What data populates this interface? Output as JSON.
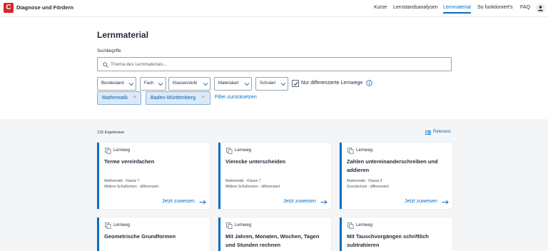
{
  "header": {
    "logo_letter": "C",
    "brand": "Diagnose und Fördern",
    "nav": [
      "Kurse",
      "Lernstandsanalysen",
      "Lernmaterial",
      "So funktioniert's",
      "FAQ"
    ],
    "active_nav": "Lernmaterial",
    "accent_color": "#0a6dc2"
  },
  "search": {
    "title": "Lernmaterial",
    "label": "Suchbegriffe",
    "placeholder": "Thema des Lernmaterials...",
    "value": ""
  },
  "filters": {
    "dropdowns": [
      "Bundesland",
      "Fach",
      "Klassenstufe",
      "Materialart",
      "Schulart"
    ],
    "checkbox_label": "Nur differenzierte Lernwege",
    "checkbox_checked": true,
    "chips": [
      "Mathematik",
      "Baden-Württemberg"
    ],
    "reset_label": "Filter zurücksetzen"
  },
  "results": {
    "count": "132 Ergebnisse",
    "sort_label": "Relevanz",
    "cards": [
      {
        "type": "Lernweg",
        "title": "Terme vereinfachen",
        "meta1": "Mathematik · Klasse 7",
        "meta2": "Mittlere Schulformen · differenziert",
        "cta": "Jetzt zuweisen"
      },
      {
        "type": "Lernweg",
        "title": "Vierecke unterscheiden",
        "meta1": "Mathematik · Klasse 7",
        "meta2": "Mittlere Schulformen · differenziert",
        "cta": "Jetzt zuweisen"
      },
      {
        "type": "Lernweg",
        "title": "Zahlen untereinanderschreiben und addieren",
        "meta1": "Mathematik · Klasse 3",
        "meta2": "Grundschule · differenziert",
        "cta": "Jetzt zuweisen"
      },
      {
        "type": "Lernweg",
        "title": "Geometrische Grundformen"
      },
      {
        "type": "Lernweg",
        "title": "Mit Jahren, Monaten, Wochen, Tagen und Stunden rechnen"
      },
      {
        "type": "Lernweg",
        "title": "Mit Tauschvorgängen schriftlich subtrahieren"
      }
    ]
  }
}
